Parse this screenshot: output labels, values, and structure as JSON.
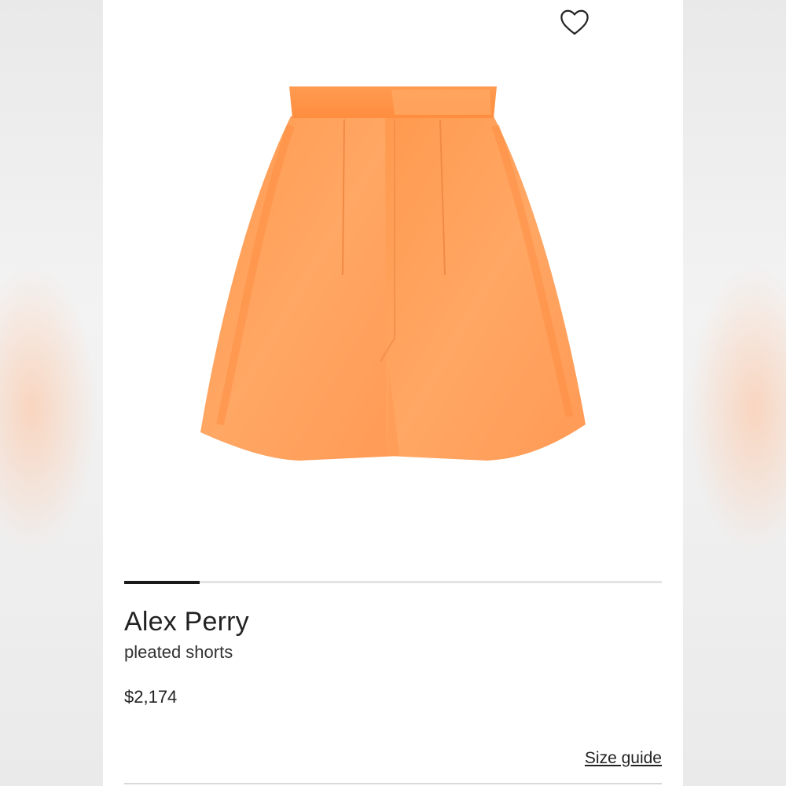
{
  "product": {
    "brand": "Alex Perry",
    "name": "pleated shorts",
    "price": "$2,174",
    "image_color": "#ff9f5a"
  },
  "carousel": {
    "current": 1,
    "total": 7,
    "progress": 0.14
  },
  "actions": {
    "wishlist_icon": "heart-outline-icon",
    "size_guide_label": "Size guide"
  },
  "colors": {
    "accent": "#1a1a1a",
    "background": "#ffffff"
  }
}
